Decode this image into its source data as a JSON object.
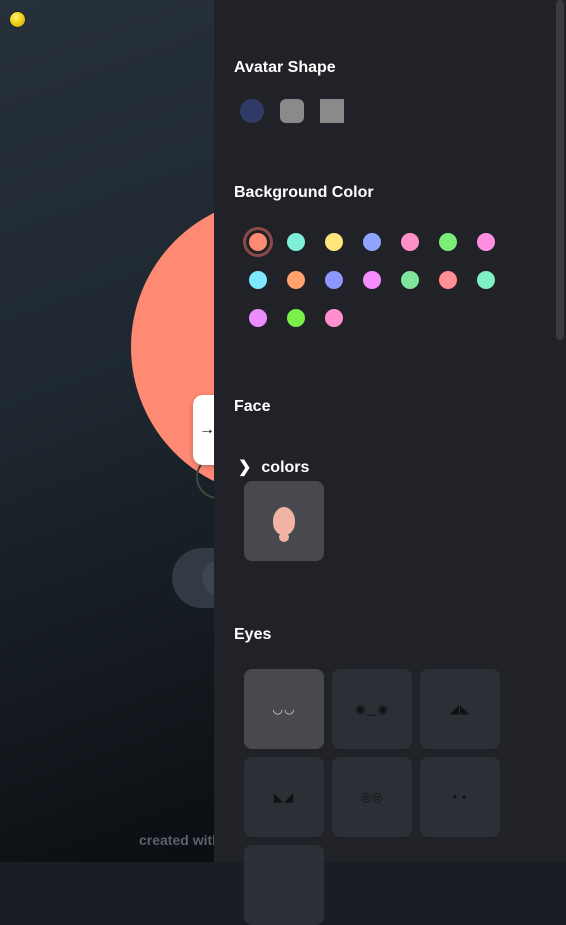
{
  "left_area": {
    "footer_text": "created with"
  },
  "panel": {
    "avatar_shape": {
      "title": "Avatar Shape",
      "options": [
        {
          "name": "circle",
          "color": "#2f3a66"
        },
        {
          "name": "rounded",
          "color": "#8a8a8a"
        },
        {
          "name": "square",
          "color": "#8a8a8a"
        }
      ]
    },
    "background_color": {
      "title": "Background Color",
      "selected_index": 0,
      "swatches": [
        "#ff8a73",
        "#7ef0d8",
        "#ffe57a",
        "#8ea4ff",
        "#ff90c8",
        "#7ded79",
        "#ff8fe0",
        "#7fe7ff",
        "#ffa26b",
        "#8e98ff",
        "#f58cff",
        "#7fe49c",
        "#ff8f95",
        "#7df0c4",
        "#eb8cff",
        "#79ef4a",
        "#ff8fcf"
      ]
    },
    "face": {
      "title": "Face",
      "colors_label": "colors"
    },
    "eyes": {
      "title": "Eyes",
      "tiles": [
        {
          "icon": "eyes-style-1-icon",
          "glyph": "◡◡"
        },
        {
          "icon": "eyes-style-2-icon",
          "glyph": "◉‿◉"
        },
        {
          "icon": "eyes-style-3-icon",
          "glyph": "◢◣"
        },
        {
          "icon": "eyes-style-4-icon",
          "glyph": "◣◢"
        },
        {
          "icon": "eyes-style-5-icon",
          "glyph": "◎◎"
        },
        {
          "icon": "eyes-style-6-icon",
          "glyph": "• •"
        }
      ]
    }
  },
  "colors": {
    "panel_bg": "#212227",
    "avatar_bg": "#ff8a73",
    "tile_bg": "#2c2f35",
    "tile_selected_bg": "#47494e"
  }
}
